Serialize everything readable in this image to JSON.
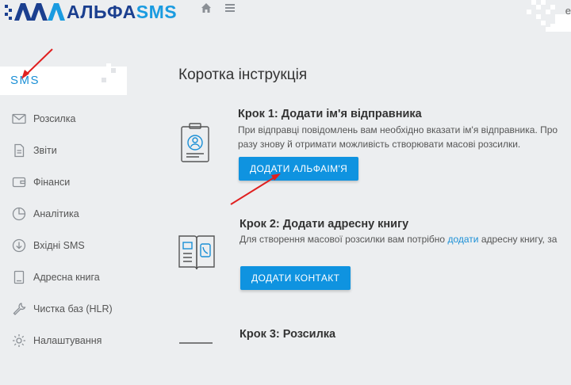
{
  "brand": {
    "text_part1": "АЛЬФА",
    "text_part2": "SMS"
  },
  "header": {
    "right_letter": "е"
  },
  "colors": {
    "accent": "#0f93e0",
    "brand_dark": "#1b3f8f",
    "arrow": "#e02020"
  },
  "sidebar": {
    "active_item": "SMS",
    "items": [
      {
        "label": "Розсилка",
        "icon": "envelope-icon"
      },
      {
        "label": "Звіти",
        "icon": "document-icon"
      },
      {
        "label": "Фінанси",
        "icon": "wallet-icon"
      },
      {
        "label": "Аналітика",
        "icon": "pie-chart-icon"
      },
      {
        "label": "Вхідні SMS",
        "icon": "download-icon"
      },
      {
        "label": "Адресна книга",
        "icon": "address-book-icon"
      },
      {
        "label": "Чистка баз (HLR)",
        "icon": "wrench-icon"
      },
      {
        "label": "Налаштування",
        "icon": "gear-icon"
      }
    ]
  },
  "main": {
    "title": "Коротка інструкція",
    "steps": [
      {
        "title": "Крок 1: Додати ім'я відправника",
        "line1": "При відправці повідомлень вам необхідно вказати ім'я відправника. Про",
        "line2": "разу знову й отримати можливість створювати масові розсилки.",
        "button": "ДОДАТИ АЛЬФАІМ'Я"
      },
      {
        "title": "Крок 2: Додати адресну книгу",
        "line1_before": "Для створення масової розсилки вам потрібно ",
        "line1_link": "додати",
        "line1_after": " адресну книгу, за",
        "button": "ДОДАТИ КОНТАКТ"
      },
      {
        "title": "Крок 3: Розсилка"
      }
    ]
  }
}
